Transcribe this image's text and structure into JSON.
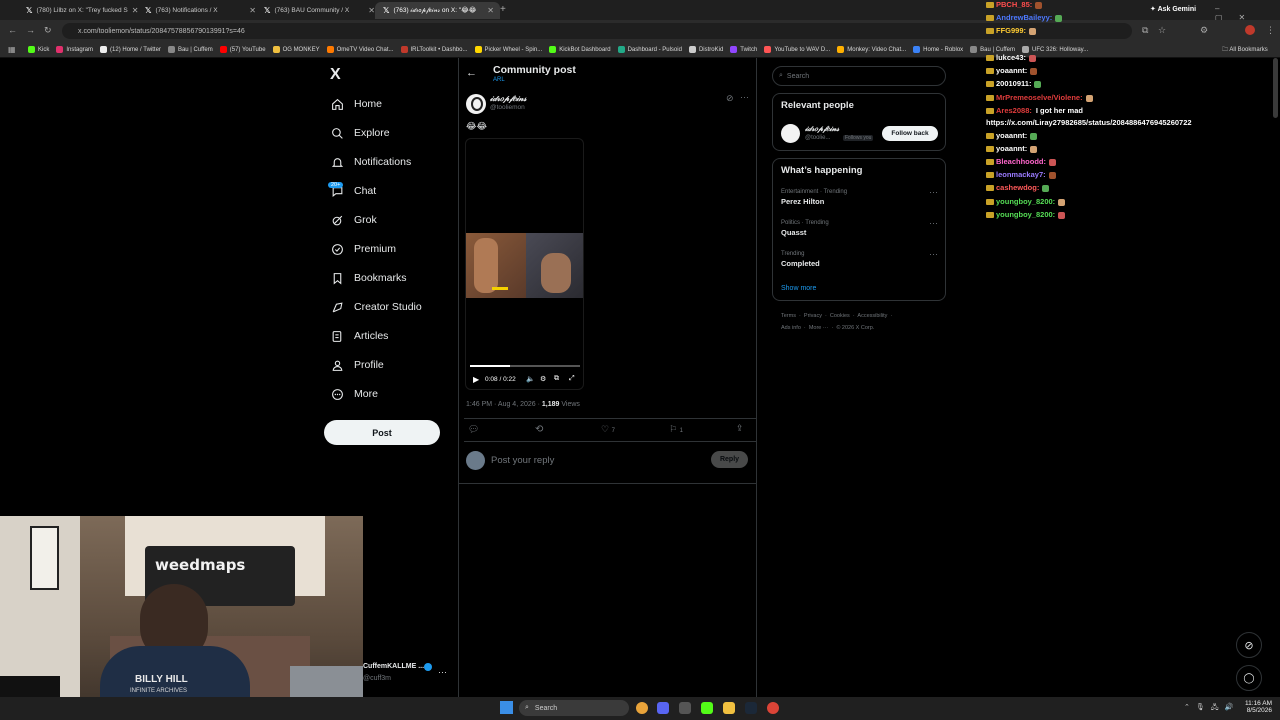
{
  "browser": {
    "tabs": [
      {
        "title": "(780) Lilbz on X: \"Trey fucked S"
      },
      {
        "title": "(763) Notifications / X"
      },
      {
        "title": "(763) BAU Community / X"
      },
      {
        "title": "(763) 𝒾𝒹𝓇𝑜𝓅𝒻𝑒𝒾𝓃𝓈 on X: \"😂😂"
      }
    ],
    "ask_gemini": "Ask Gemini",
    "url": "x.com/tooliemon/status/2084757885679013991?s=46",
    "bookmarks": [
      "Kick",
      "Instagram",
      "(12) Home / Twitter",
      "Bau | Cuffem",
      "(57) YouTube",
      "OG MONKEY",
      "OmeTV Video Chat...",
      "IRLToolkit • Dashbo...",
      "Picker Wheel - Spin...",
      "KickBot Dashboard",
      "Dashboard - Pulsoid",
      "DistroKid",
      "Twitch",
      "YouTube to WAV D...",
      "Monkey: Video Chat...",
      "Home - Roblox",
      "Bau | Cuffem",
      "UFC 326: Holloway..."
    ],
    "all_bookmarks": "All Bookmarks"
  },
  "x_nav": {
    "logo": "X",
    "items": [
      {
        "label": "Home",
        "icon": "home-icon"
      },
      {
        "label": "Explore",
        "icon": "search-icon"
      },
      {
        "label": "Notifications",
        "icon": "bell-icon"
      },
      {
        "label": "Chat",
        "icon": "chat-icon",
        "badge": "20+"
      },
      {
        "label": "Grok",
        "icon": "grok-icon"
      },
      {
        "label": "Premium",
        "icon": "premium-icon"
      },
      {
        "label": "Bookmarks",
        "icon": "bookmark-icon"
      },
      {
        "label": "Creator Studio",
        "icon": "creator-icon"
      },
      {
        "label": "Articles",
        "icon": "articles-icon"
      },
      {
        "label": "Profile",
        "icon": "profile-icon"
      },
      {
        "label": "More",
        "icon": "more-icon"
      }
    ],
    "post_button": "Post",
    "account_name": "CuffemKALLME ...",
    "account_handle": "@cuff3m"
  },
  "post": {
    "header_title": "Community post",
    "header_sub": "ARL",
    "author_name": "𝒾𝒹𝓇𝑜𝓅𝒻𝑒𝒾𝓃𝓈",
    "author_handle": "@tooliemon",
    "text": "😂😂",
    "video_time": "0:08 / 0:22",
    "video_progress": 0.36,
    "timestamp": "1:46 PM · Aug 4, 2026 · ",
    "views_count": "1,189",
    "views_label": " Views",
    "likes": "7",
    "bookmarks": "1",
    "reply_placeholder": "Post your reply",
    "reply_button": "Reply"
  },
  "sidebar": {
    "search_placeholder": "Search",
    "relevant_title": "Relevant people",
    "relevant_name": "𝒾𝒹𝓇𝑜𝓅𝒻𝑒𝒾𝓃𝓈",
    "relevant_handle": "@toolie...",
    "follows_you": "Follows you",
    "follow_back": "Follow back",
    "happening_title": "What’s happening",
    "trends": [
      {
        "context": "Entertainment · Trending",
        "name": "Perez Hilton"
      },
      {
        "context": "Politics · Trending",
        "name": "Quasst"
      },
      {
        "context": "Trending",
        "name": "Completed"
      }
    ],
    "show_more": "Show more",
    "footer_line1": "Terms  ·  Privacy  ·  Cookies  ·  Accessibility  ·",
    "footer_line2": "Ads info  ·  More ···  ·  © 2026 X Corp."
  },
  "chat": {
    "messages": [
      {
        "user": "PBCH_85:",
        "text": "",
        "color": "#ff4d4d"
      },
      {
        "user": "AndrewBaileyy:",
        "text": "",
        "color": "#4d79ff"
      },
      {
        "user": "FFG999:",
        "text": "",
        "color": "#ffcc33"
      },
      {
        "user": "lukce43:",
        "text": "",
        "color": "#ffffff"
      },
      {
        "user": "yoaannt:",
        "text": "",
        "color": "#ffffff"
      },
      {
        "user": "20010911:",
        "text": "",
        "color": "#ffffff"
      },
      {
        "user": "MrPremeoselve/Violene:",
        "text": "",
        "color": "#e03c3c"
      },
      {
        "user": "Ares2088:",
        "text": "I got her mad",
        "color": "#e03c3c"
      },
      {
        "user": "",
        "text": "https://x.com/Liray27982685/status/2084886476945260722",
        "color": "#ffffff"
      },
      {
        "user": "yoaannt:",
        "text": "",
        "color": "#ffffff"
      },
      {
        "user": "yoaannt:",
        "text": "",
        "color": "#ffffff"
      },
      {
        "user": "Bleachhoodd:",
        "text": "",
        "color": "#ff66cc"
      },
      {
        "user": "leonmackay7:",
        "text": "",
        "color": "#9b7bff"
      },
      {
        "user": "cashewdog:",
        "text": "",
        "color": "#ff5a5a"
      },
      {
        "user": "youngboy_8200:",
        "text": "",
        "color": "#55dd55"
      },
      {
        "user": "youngboy_8200:",
        "text": "",
        "color": "#55dd55"
      }
    ]
  },
  "stream": {
    "banner_text": "weedmaps",
    "shirt_text": "BILLY HILL",
    "shirt_sub": "INFINITE ARCHIVES"
  },
  "taskbar": {
    "search": "Search",
    "time": "11:16 AM",
    "date": "8/5/2026"
  }
}
